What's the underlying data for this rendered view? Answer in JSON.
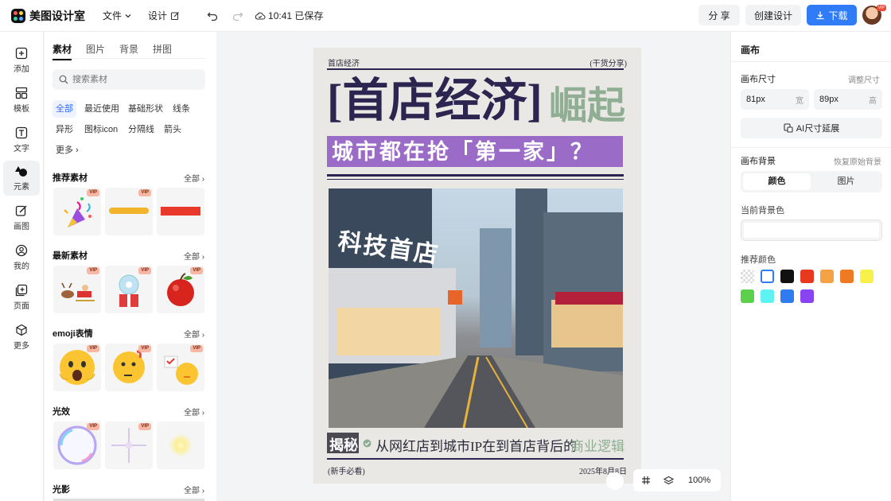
{
  "app": {
    "name": "美图设计室"
  },
  "menu": {
    "file": "文件",
    "design": "设计",
    "save_status": "10:41 已保存"
  },
  "actions": {
    "share": "分 享",
    "create": "创建设计",
    "download": "下载"
  },
  "rail": [
    {
      "label": "添加",
      "icon": "plus-square-icon"
    },
    {
      "label": "模板",
      "icon": "template-icon"
    },
    {
      "label": "文字",
      "icon": "text-icon"
    },
    {
      "label": "元素",
      "icon": "shapes-icon"
    },
    {
      "label": "画图",
      "icon": "draw-icon"
    },
    {
      "label": "我的",
      "icon": "user-icon"
    },
    {
      "label": "页面",
      "icon": "page-add-icon"
    },
    {
      "label": "更多",
      "icon": "cube-icon"
    }
  ],
  "panel": {
    "tabs": [
      "素材",
      "图片",
      "背景",
      "拼图"
    ],
    "search_placeholder": "搜索素材",
    "chips": [
      "全部",
      "最近使用",
      "基础形状",
      "线条",
      "异形",
      "图标icon",
      "分隔线",
      "箭头",
      "更多"
    ],
    "all_label": "全部",
    "vip": "VIP",
    "sections": [
      "推荐素材",
      "最新素材",
      "emoji表情",
      "光效",
      "光影"
    ]
  },
  "poster": {
    "top_left": "首店经济",
    "top_right": "(干货分享)",
    "headline": "[首店经济]",
    "headline_accent": "崛起",
    "subhead": "城市都在抢「第一家」？",
    "photo_sign": "科技首店",
    "reveal_tag": "揭秘",
    "reveal_text": "从网红店到城市IP在到首店背后的",
    "reveal_accent": "商业逻辑",
    "bottom_left": "(新手必看)",
    "bottom_right": "2025年8月8日"
  },
  "right": {
    "title": "画布",
    "size_label": "画布尺寸",
    "adjust_size": "调整尺寸",
    "width_value": "81px",
    "width_unit": "宽",
    "height_value": "89px",
    "height_unit": "高",
    "ai_extend": "AI尺寸延展",
    "bg_label": "画布背景",
    "restore_bg": "恢复原始背景",
    "bg_tabs": [
      "颜色",
      "图片"
    ],
    "current_bg": "当前背景色",
    "recommend_colors": "推荐颜色",
    "colors": [
      "#ffffff",
      "#111111",
      "#e8391f",
      "#f4a244",
      "#f07a23",
      "#f8f14a",
      "#5bd14b",
      "#5ef2f2",
      "#2f7cf0",
      "#8a43f0"
    ]
  },
  "zoom": {
    "value": "100%"
  },
  "colors": {
    "accent": "#2f7cf6",
    "poster_purple": "#9b6bc8",
    "poster_green": "#8fae93",
    "poster_dark": "#2b2550"
  }
}
